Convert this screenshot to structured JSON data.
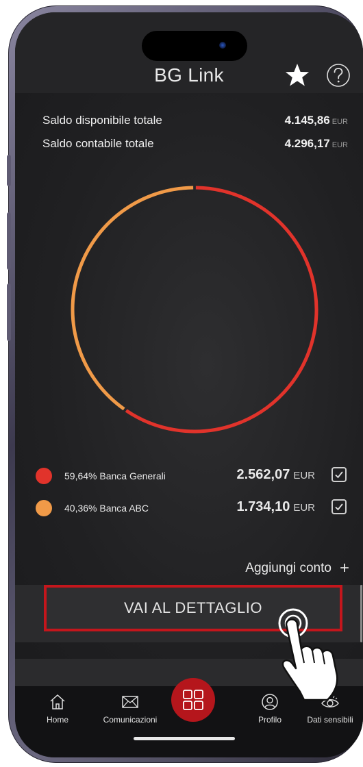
{
  "app": {
    "title": "BG Link"
  },
  "header": {
    "favorite_icon": "star-icon",
    "help_icon": "help-icon"
  },
  "balances": {
    "available": {
      "label": "Saldo disponibile totale",
      "value": "4.145,86",
      "currency": "EUR"
    },
    "accounting": {
      "label": "Saldo contabile totale",
      "value": "4.296,17",
      "currency": "EUR"
    }
  },
  "chart_data": {
    "type": "pie",
    "categories": [
      "Banca Generali",
      "Banca ABC"
    ],
    "values": [
      59.64,
      40.36
    ],
    "colors": [
      "#e1332b",
      "#f09a48"
    ],
    "donut": true
  },
  "accounts": [
    {
      "percent": "59,64%",
      "name": "Banca Generali",
      "amount": "2.562,07",
      "currency": "EUR",
      "color": "#e1332b",
      "checked": true
    },
    {
      "percent": "40,36%",
      "name": "Banca ABC",
      "amount": "1.734,10",
      "currency": "EUR",
      "color": "#f09a48",
      "checked": true
    }
  ],
  "actions": {
    "add_account": "Aggiungi conto",
    "add_plus": "+",
    "detail_button": "VAI AL DETTAGLIO"
  },
  "tabbar": {
    "items": [
      {
        "label": "Home",
        "icon": "home-icon"
      },
      {
        "label": "Comunicazioni",
        "icon": "envelope-icon"
      },
      {
        "label": "",
        "icon": "grid-icon"
      },
      {
        "label": "Profilo",
        "icon": "user-icon"
      },
      {
        "label": "Dati sensibili",
        "icon": "eye-icon"
      }
    ]
  }
}
